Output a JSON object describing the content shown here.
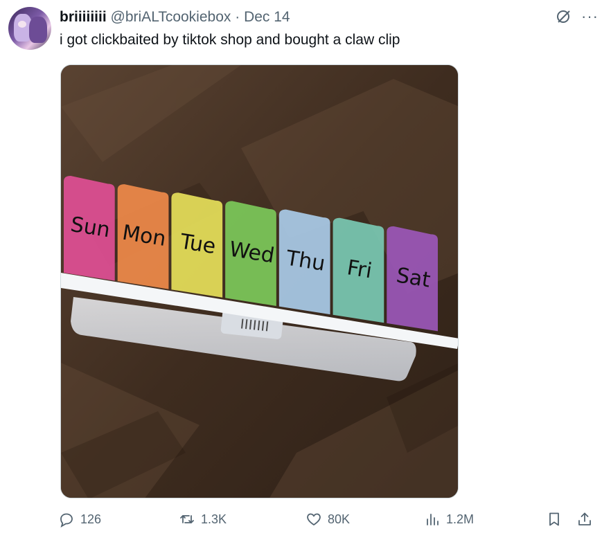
{
  "author": {
    "display_name": "briiiiiiii",
    "handle": "@briALTcookiebox",
    "separator": "·",
    "date": "Dec 14"
  },
  "tweet": {
    "text": "i got clickbaited by tiktok shop and bought a claw clip"
  },
  "image": {
    "compartment_labels": [
      "Sun",
      "Mon",
      "Tue",
      "Wed",
      "Thu",
      "Fri",
      "Sat"
    ],
    "compartment_colors": [
      "#e04f95",
      "#ef8a4a",
      "#e6e05a",
      "#7cc95a",
      "#a9cbe8",
      "#79c9b3",
      "#9b57b9"
    ]
  },
  "metrics": {
    "replies": "126",
    "reposts": "1.3K",
    "likes": "80K",
    "views": "1.2M"
  },
  "icons": {
    "reply": "reply-icon",
    "repost": "repost-icon",
    "like": "heart-icon",
    "views": "views-icon",
    "bookmark": "bookmark-icon",
    "share": "share-icon",
    "grok": "grok-icon",
    "more": "more-icon"
  }
}
